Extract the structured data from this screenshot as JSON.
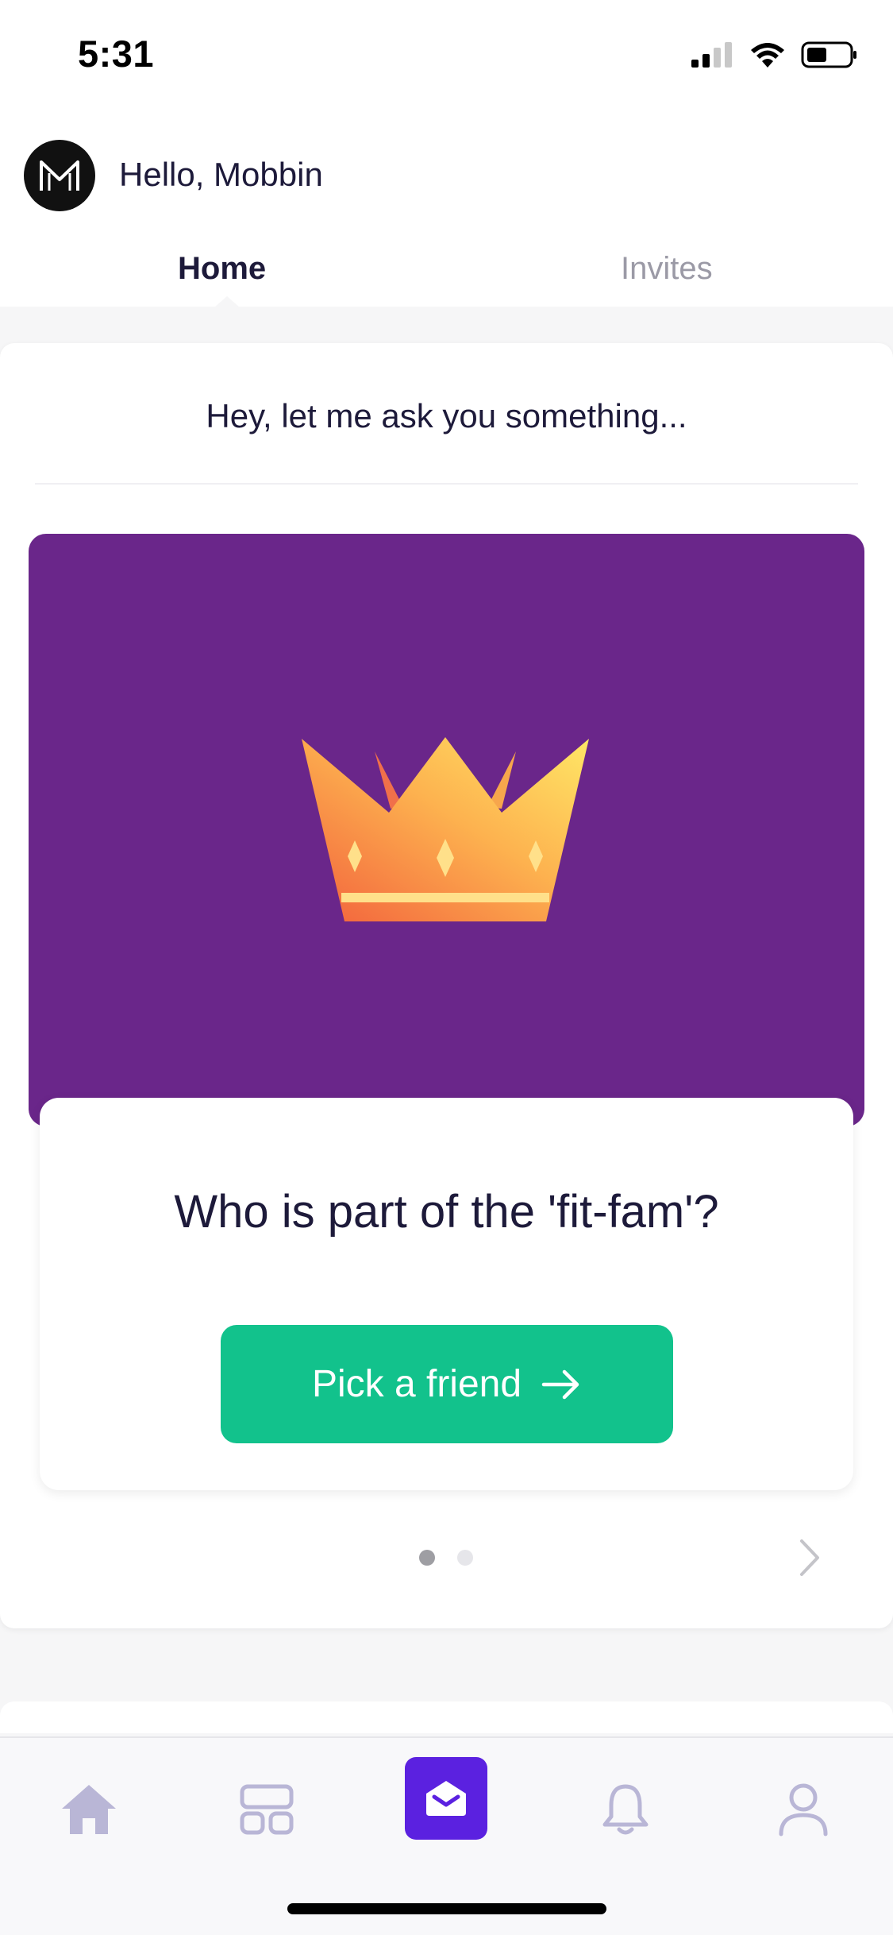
{
  "status_bar": {
    "time": "5:31"
  },
  "header": {
    "greeting": "Hello, Mobbin"
  },
  "tabs": [
    {
      "label": "Home",
      "active": true
    },
    {
      "label": "Invites",
      "active": false
    }
  ],
  "main": {
    "prompt": "Hey, let me ask you something...",
    "question": "Who is part of the 'fit-fam'?",
    "pick_button_label": "Pick a friend",
    "pagination": {
      "current": 1,
      "total": 2
    }
  },
  "colors": {
    "card_background": "#6a268a",
    "primary_button": "#12c28c",
    "nav_active": "#5b21e0",
    "nav_inactive": "#b9b6d6"
  },
  "bottom_nav": [
    {
      "icon": "home-icon"
    },
    {
      "icon": "feed-icon"
    },
    {
      "icon": "inbox-icon",
      "active": true
    },
    {
      "icon": "bell-icon"
    },
    {
      "icon": "profile-icon"
    }
  ]
}
